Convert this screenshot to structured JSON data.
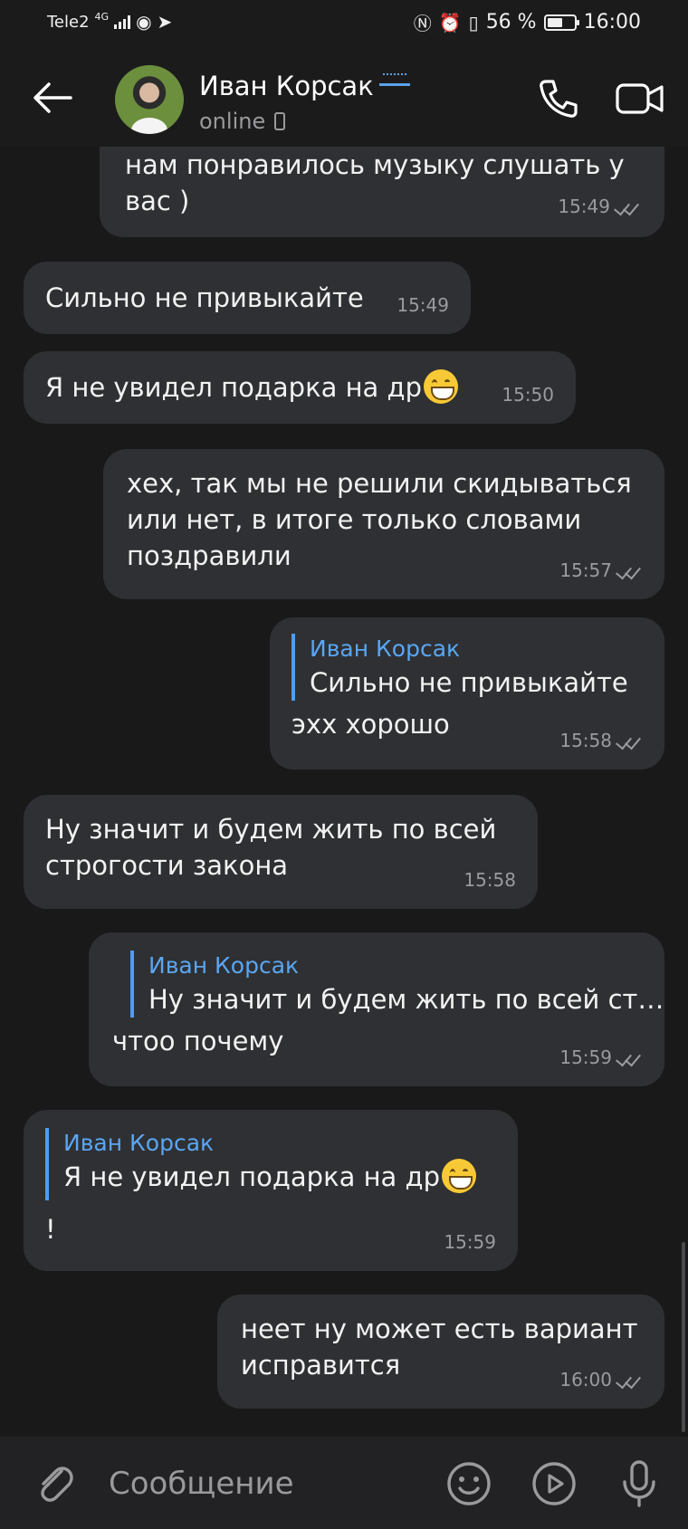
{
  "status_bar": {
    "carrier": "Tele2",
    "network": "4G",
    "battery": "56 %",
    "time": "16:00"
  },
  "header": {
    "contact_name": "Иван Корсак",
    "status": "online"
  },
  "messages": [
    {
      "side": "out",
      "text": "нам понравилось музыку слушать у\nвас )",
      "time": "15:49"
    },
    {
      "side": "in",
      "text": "Сильно не привыкайте",
      "time": "15:49"
    },
    {
      "side": "in",
      "text": "Я не увидел подарка на др",
      "time": "15:50"
    },
    {
      "side": "out",
      "text": "хех, так мы не решили скидываться\nили нет, в итоге только словами\nпоздравили",
      "time": "15:57"
    },
    {
      "side": "out",
      "reply_name": "Иван Корсак",
      "reply_text": "Сильно не привыкайте",
      "text": "эхх хорошо",
      "time": "15:58"
    },
    {
      "side": "in",
      "text": "Ну значит и будем жить по всей\nстрогости закона",
      "time": "15:58"
    },
    {
      "side": "out",
      "reply_name": "Иван Корсак",
      "reply_text": "Ну значит и будем жить по всей ст…",
      "text": "чтоо почему",
      "time": "15:59"
    },
    {
      "side": "in",
      "reply_name": "Иван Корсак",
      "reply_text": "Я не увидел подарка на др",
      "text": "!",
      "time": "15:59"
    },
    {
      "side": "out",
      "text": "неет ну может есть вариант\nисправится",
      "time": "16:00"
    }
  ],
  "composer": {
    "placeholder": "Сообщение"
  },
  "colors": {
    "background": "#19191a",
    "bubble": "#2f3033",
    "reply_accent": "#4f9df0",
    "muted": "#9a9b9e"
  }
}
